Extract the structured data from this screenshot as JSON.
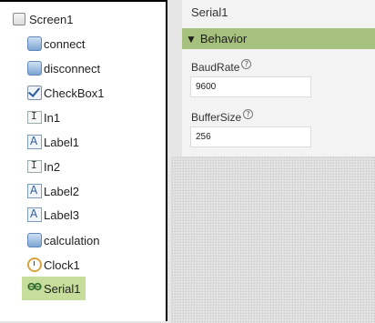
{
  "tree": {
    "items": [
      {
        "label": "Screen1",
        "icon": "screen-icon"
      },
      {
        "label": "connect",
        "icon": "button-icon"
      },
      {
        "label": "disconnect",
        "icon": "button-icon"
      },
      {
        "label": "CheckBox1",
        "icon": "checkbox-icon"
      },
      {
        "label": "In1",
        "icon": "textbox-icon"
      },
      {
        "label": "Label1",
        "icon": "label-icon"
      },
      {
        "label": "In2",
        "icon": "textbox-icon"
      },
      {
        "label": "Label2",
        "icon": "label-icon"
      },
      {
        "label": "Label3",
        "icon": "label-icon"
      },
      {
        "label": "calculation",
        "icon": "button-icon"
      },
      {
        "label": "Clock1",
        "icon": "clock-icon"
      },
      {
        "label": "Serial1",
        "icon": "serial-icon",
        "selected": true
      }
    ]
  },
  "props": {
    "title": "Serial1",
    "section": "Behavior",
    "baud_label": "BaudRate",
    "baud_value": "9600",
    "buffer_label": "BufferSize",
    "buffer_value": "256",
    "help_glyph": "?"
  },
  "colors": {
    "section_header": "#a6c07d",
    "selected_item": "#c6dd9c"
  }
}
